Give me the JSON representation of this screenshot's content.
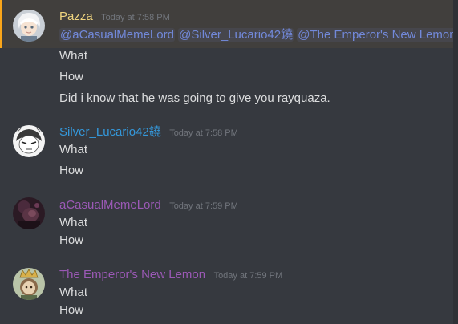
{
  "colors": {
    "background": "#36393f",
    "mention_bar": "#faa61a",
    "mention_text": "#7289da",
    "timestamp": "#72767d",
    "message_text": "#dcddde"
  },
  "messages": [
    {
      "username": "Pazza",
      "username_color": "#f0d57f",
      "timestamp": "Today at 7:58 PM",
      "avatar_icon": "white-haired-character-avatar",
      "mentions": [
        "@aCasualMemeLord",
        "@Silver_Lucario42鐃",
        "@The Emperor's New Lemon"
      ],
      "lines": [
        "What",
        "How",
        "Did i know that he was going to give you rayquaza."
      ]
    },
    {
      "username": "Silver_Lucario42鐃",
      "username_color": "#3498db",
      "timestamp": "Today at 7:58 PM",
      "avatar_icon": "sketch-character-avatar",
      "lines": [
        "What",
        "How"
      ]
    },
    {
      "username": "aCasualMemeLord",
      "username_color": "#9b59b6",
      "timestamp": "Today at 7:59 PM",
      "avatar_icon": "dark-photo-avatar",
      "lines": [
        "What",
        "How"
      ]
    },
    {
      "username": "The Emperor's New Lemon",
      "username_color": "#9b59b6",
      "timestamp": "Today at 7:59 PM",
      "avatar_icon": "crowned-character-avatar",
      "lines": [
        "What",
        "How"
      ]
    }
  ]
}
